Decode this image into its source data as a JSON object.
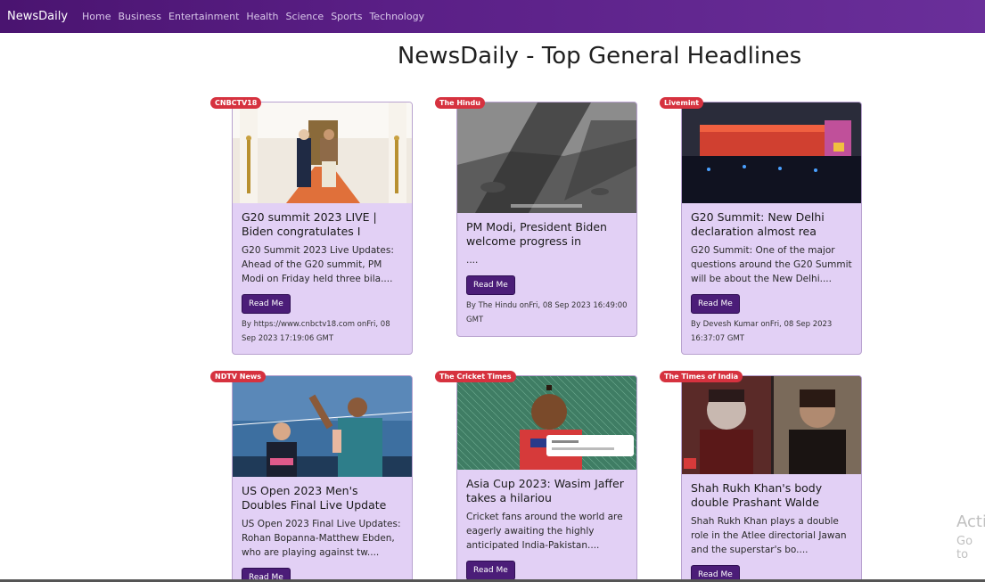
{
  "nav": {
    "brand": "NewsDaily",
    "links": [
      "Home",
      "Business",
      "Entertainment",
      "Health",
      "Science",
      "Sports",
      "Technology"
    ]
  },
  "page_title": "NewsDaily - Top General Headlines",
  "cards": [
    {
      "source": "CNBCTV18",
      "title": "G20 summit 2023 LIVE | Biden congratulates I",
      "desc": "G20 Summit 2023 Live Updates: Ahead of the G20 summit, PM Modi on Friday held three bila....",
      "button": "Read Me",
      "byline": "By https://www.cnbctv18.com onFri, 08 Sep 2023 17:19:06 GMT"
    },
    {
      "source": "The Hindu",
      "title": "PM Modi, President Biden welcome progress in",
      "desc": "....",
      "button": "Read Me",
      "byline": "By The Hindu onFri, 08 Sep 2023 16:49:00 GMT"
    },
    {
      "source": "Livemint",
      "title": "G20 Summit: New Delhi declaration almost rea",
      "desc": "G20 Summit: One of the major questions around the G20 Summit will be about the New Delhi....",
      "button": "Read Me",
      "byline": "By Devesh Kumar onFri, 08 Sep 2023 16:37:07 GMT"
    },
    {
      "source": "NDTV News",
      "title": "US Open 2023 Men's Doubles Final Live Update",
      "desc": "US Open 2023 Final Live Updates: Rohan Bopanna-Matthew Ebden, who are playing against tw....",
      "button": "Read Me",
      "byline": ""
    },
    {
      "source": "The Cricket Times",
      "title": "Asia Cup 2023: Wasim Jaffer takes a hilariou",
      "desc": "Cricket fans around the world are eagerly awaiting the highly anticipated India-Pakistan....",
      "button": "Read Me",
      "byline": ""
    },
    {
      "source": "The Times of India",
      "title": "Shah Rukh Khan's body double Prashant Walde",
      "desc": "Shah Rukh Khan plays a double role in the Atlee directorial Jawan and the superstar's bo....",
      "button": "Read Me",
      "byline": ""
    }
  ],
  "watermark": {
    "line1": "Acti",
    "line2": "Go to"
  },
  "colors": {
    "nav_bg": "#5a1f86",
    "card_bg": "#e2d0f5",
    "badge_bg": "#d6323f",
    "button_bg": "#4b1d78"
  }
}
